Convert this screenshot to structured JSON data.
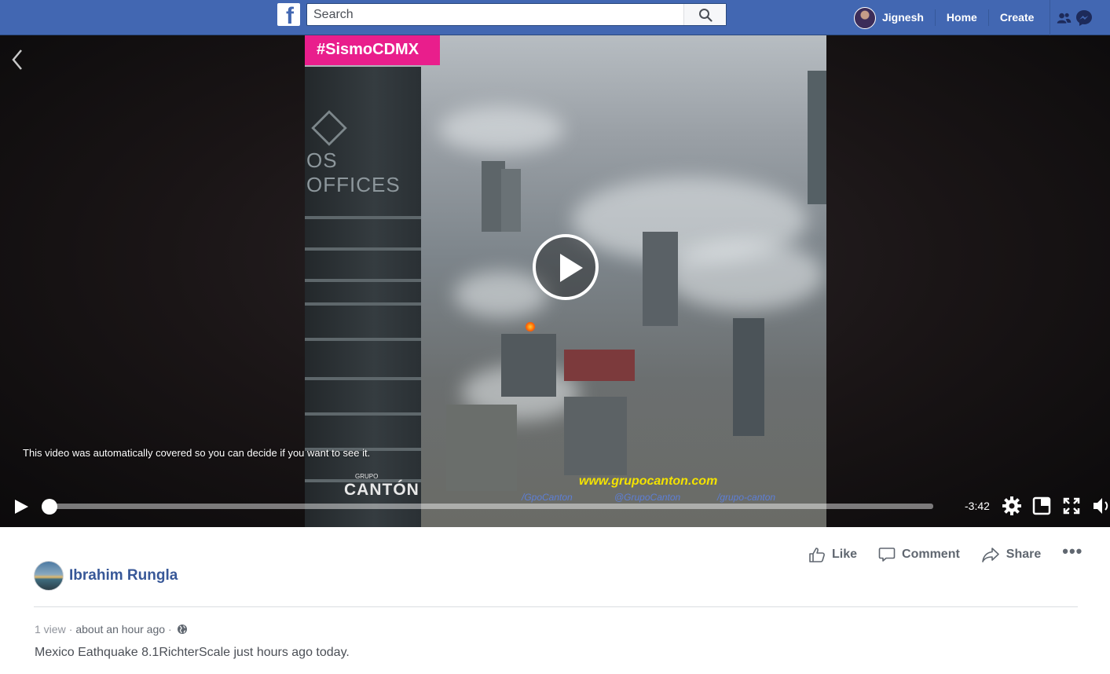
{
  "header": {
    "search_placeholder": "Search",
    "user_name": "Jignesh",
    "home_label": "Home",
    "create_label": "Create",
    "accent_color": "#4267b2"
  },
  "video": {
    "overlay_tag": "#SismoCDMX",
    "offices_text": "OS OFFICES",
    "watermark_brand_small": "GRUPO",
    "watermark_brand": "CANTÓN",
    "watermark_url": "www.grupocanton.com",
    "watermark_socials": [
      "/GpoCanton",
      "@GrupoCanton",
      "/grupo-canton"
    ],
    "cover_notice": "This video was automatically covered so you can decide if you want to see it.",
    "time_remaining": "-3:42",
    "progress_fraction": 0.0,
    "icons": [
      "back-chevron-icon",
      "play-icon",
      "settings-gear-icon",
      "popout-icon",
      "fullscreen-icon",
      "volume-icon"
    ]
  },
  "post": {
    "actions": {
      "like_label": "Like",
      "comment_label": "Comment",
      "share_label": "Share",
      "more_label": "•••"
    },
    "author_name": "Ibrahim Rungla",
    "views": "1 view",
    "separator": "·",
    "time_ago": "about an hour ago",
    "caption": "Mexico Eathquake 8.1RichterScale just hours ago today.",
    "link_color": "#385898"
  }
}
